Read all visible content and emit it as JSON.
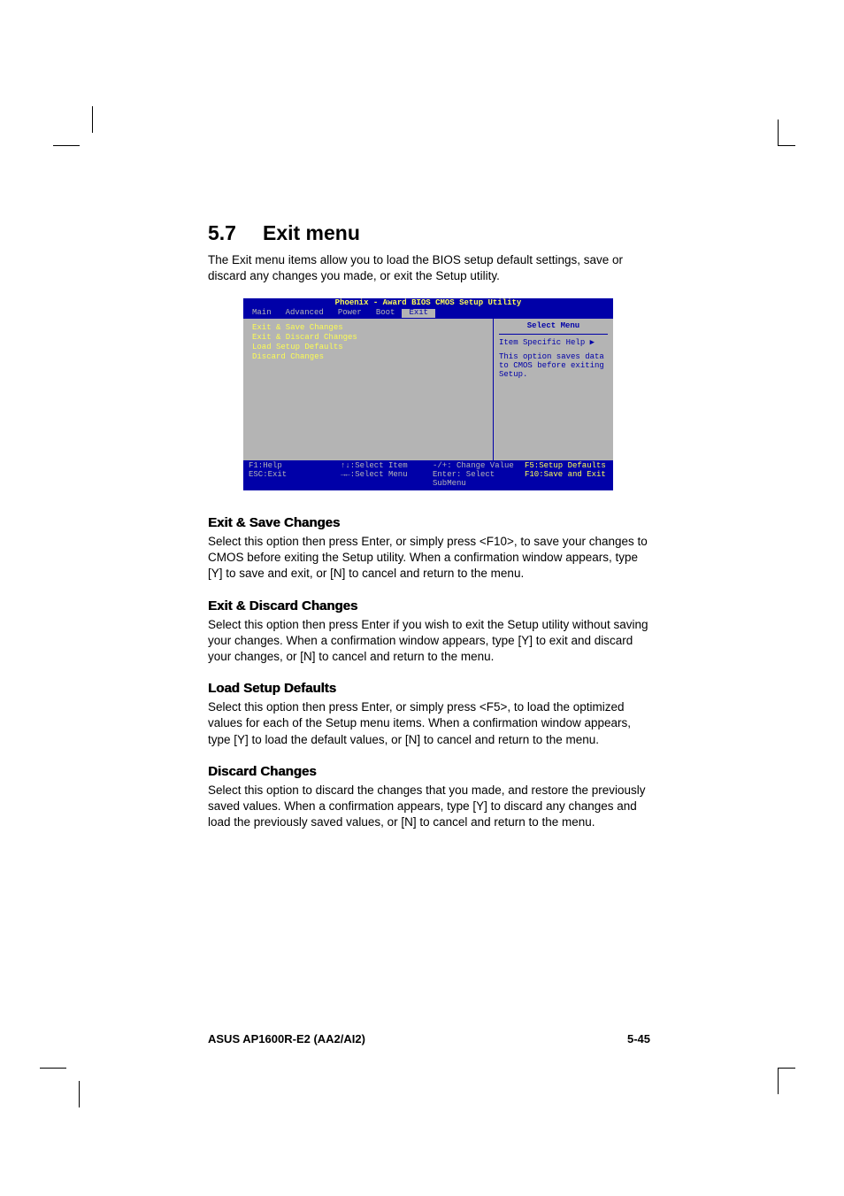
{
  "section": {
    "number": "5.7",
    "title": "Exit menu"
  },
  "intro": "The Exit menu items allow you to load the BIOS setup default settings, save or discard any changes you made, or exit the Setup utility.",
  "bios": {
    "titlebar": "Phoenix - Award BIOS CMOS Setup Utility",
    "tabs": [
      "Main",
      "Advanced",
      "Power",
      "Boot",
      "Exit"
    ],
    "activeTab": "Exit",
    "items": [
      "Exit & Save Changes",
      "Exit & Discard Changes",
      "Load Setup Defaults",
      "Discard Changes"
    ],
    "rightTitle": "Select Menu",
    "rightSub": "Item Specific Help ▶",
    "rightText": "This option saves data to CMOS before exiting Setup.",
    "footer": {
      "f1": "F1:Help",
      "esc": "ESC:Exit",
      "updown": "↑↓:Select Item",
      "leftright": "→←:Select Menu",
      "change": "-/+: Change Value",
      "enter": "Enter: Select SubMenu",
      "f5": "F5:Setup Defaults",
      "f10": "F10:Save and Exit"
    }
  },
  "sub1": {
    "heading": "Exit & Save Changes",
    "text": "Select this option then press Enter, or simply press <F10>, to save your changes to CMOS before exiting the Setup utility. When a confirmation window appears, type [Y] to save and exit, or [N] to cancel and return to the menu."
  },
  "sub2": {
    "heading": "Exit & Discard Changes",
    "text": "Select this option then press Enter if you wish to exit the Setup utility without saving your changes. When a confirmation window appears, type [Y] to exit and discard your changes, or [N] to cancel and return to the menu."
  },
  "sub3": {
    "heading": "Load Setup Defaults",
    "text": "Select this option then press Enter, or simply press <F5>, to load the optimized values for each of the Setup menu items. When a confirmation window appears, type [Y] to load the default values, or [N] to cancel and return to the menu."
  },
  "sub4": {
    "heading": "Discard Changes",
    "text": "Select this option to discard the changes that you made, and restore the previously saved values. When a confirmation appears, type [Y] to discard any changes and load the previously saved values, or [N] to cancel and return to the menu."
  },
  "footer": {
    "left": "ASUS AP1600R-E2 (AA2/AI2)",
    "right": "5-45"
  }
}
